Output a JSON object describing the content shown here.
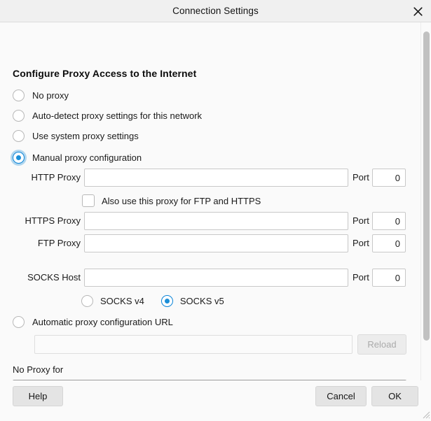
{
  "window": {
    "title": "Connection Settings",
    "close_icon": "close-icon"
  },
  "main": {
    "heading": "Configure Proxy Access to the Internet",
    "proxy_mode_options": [
      {
        "label": "No proxy",
        "selected": false
      },
      {
        "label": "Auto-detect proxy settings for this network",
        "selected": false
      },
      {
        "label": "Use system proxy settings",
        "selected": false
      },
      {
        "label": "Manual proxy configuration",
        "selected": true
      },
      {
        "label": "Automatic proxy configuration URL",
        "selected": false
      }
    ],
    "fields": [
      {
        "label": "HTTP Proxy",
        "value": "",
        "port_label": "Port",
        "port_value": "0"
      },
      {
        "label": "HTTPS Proxy",
        "value": "",
        "port_label": "Port",
        "port_value": "0"
      },
      {
        "label": "FTP Proxy",
        "value": "",
        "port_label": "Port",
        "port_value": "0"
      },
      {
        "label": "SOCKS Host",
        "value": "",
        "port_label": "Port",
        "port_value": "0"
      }
    ],
    "share_proxy_checkbox": {
      "label": "Also use this proxy for FTP and HTTPS",
      "checked": false
    },
    "socks_version": {
      "v4_label": "SOCKS v4",
      "v5_label": "SOCKS v5",
      "selected": "SOCKS v5"
    },
    "pac": {
      "url_value": "",
      "reload_label": "Reload",
      "disabled": true
    },
    "no_proxy": {
      "label": "No Proxy for",
      "value": ""
    }
  },
  "footer": {
    "help_label": "Help",
    "cancel_label": "Cancel",
    "ok_label": "OK"
  },
  "colors": {
    "accent": "#1b8fd8",
    "titlebar_bg": "#f0f0f0",
    "body_bg": "#fafafa",
    "button_bg": "#e4e4e4"
  }
}
